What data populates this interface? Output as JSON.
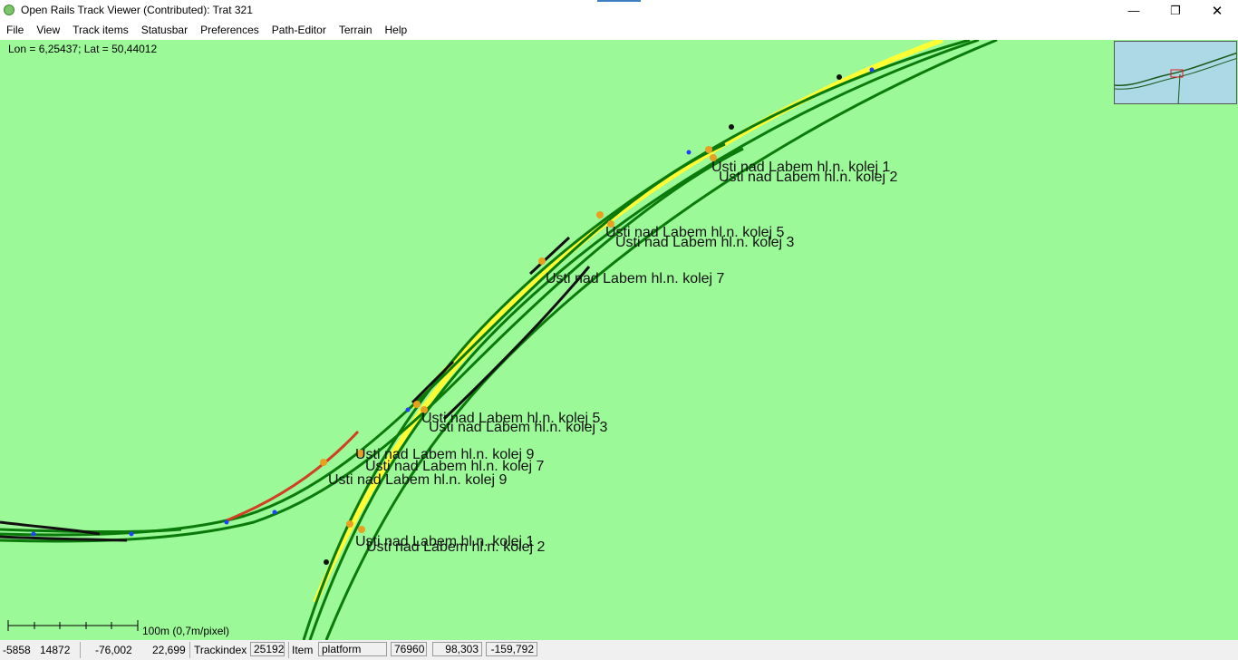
{
  "window": {
    "title": "Open Rails Track Viewer (Contributed): Trat 321",
    "minimize_glyph": "—",
    "maximize_glyph": "❐",
    "close_glyph": "✕"
  },
  "menu": [
    "File",
    "View",
    "Track items",
    "Statusbar",
    "Preferences",
    "Path-Editor",
    "Terrain",
    "Help"
  ],
  "map": {
    "coordinates": "Lon = 6,25437; Lat = 50,44012",
    "scale_label": "100m (0,7m/pixel)",
    "background_color": "#9cf998",
    "track_color": "#0a7a0a",
    "platform_color": "#ffff33",
    "platform_labels": [
      "Usti nad Labem hl.n. kolej 1",
      "Usti nad Labem hl.n. kolej 2",
      "Usti nad Labem hl.n. kolej 5",
      "Usti nad Labem hl.n. kolej 3",
      "Usti nad Labem hl.n. kolej 7",
      "Usti nad Labem hl.n. kolej 5",
      "Usti nad Labem hl.n. kolej 3",
      "Usti nad Labem hl.n. kolej 9",
      "Usti nad Labem hl.n. kolej 7",
      "Usti nad Labem hl.n. kolej 9",
      "Usti nad Labem hl.n. kolej 1",
      "Usti nad Labem hl.n. kolej 2"
    ]
  },
  "statusbar": {
    "mouse_x": "-5858",
    "mouse_z": "14872",
    "world_x": "-76,002",
    "world_z": "22,699",
    "trackindex_label": "Trackindex",
    "trackindex_value": "25192",
    "item_label": "Item",
    "item_value": "platform",
    "item_index": "76960",
    "pos_a": "98,303",
    "pos_b": "-159,792"
  }
}
